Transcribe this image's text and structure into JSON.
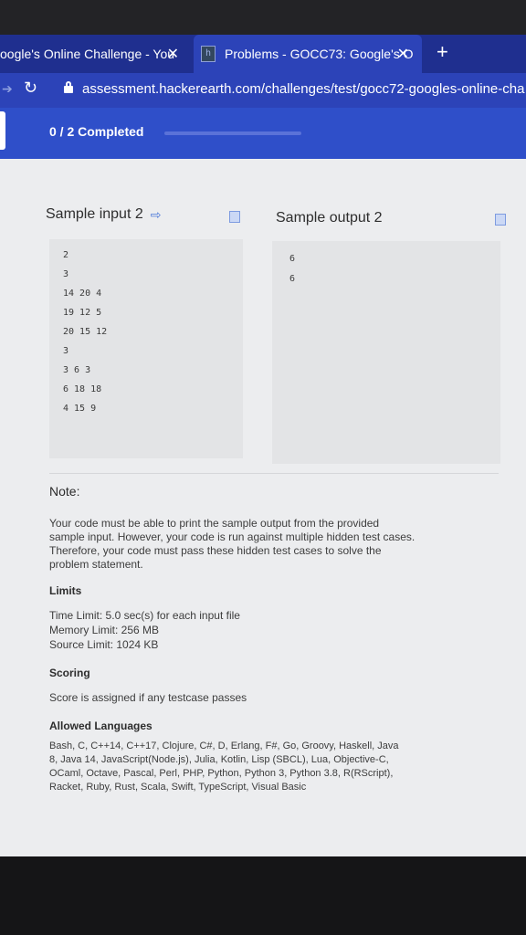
{
  "browser": {
    "tabs": [
      {
        "title": "oogle's Online Challenge - You",
        "close": "✕",
        "active": false
      },
      {
        "title": "Problems - GOCC73: Google's O",
        "close": "✕",
        "active": true
      }
    ],
    "new_tab": "+",
    "url": "assessment.hackerearth.com/challenges/test/gocc72-googles-online-cha"
  },
  "progress": {
    "text": "0 / 2 Completed",
    "fraction": 0.0
  },
  "sample_input": {
    "heading": "Sample input 2",
    "lines": [
      "2",
      "3",
      "14 20 4",
      "19 12 5",
      "20 15 12",
      "3",
      "3 6 3",
      "6 18 18",
      "4 15 9"
    ]
  },
  "sample_output": {
    "heading": "Sample output 2",
    "lines": [
      "6",
      "6"
    ]
  },
  "note": {
    "title": "Note:",
    "lines": [
      "Your code must be able to print the sample output from the provided",
      "sample input. However, your code is run against multiple hidden test cases.",
      "Therefore, your code must pass these hidden test cases to solve the",
      "problem statement."
    ]
  },
  "limits": {
    "title": "Limits",
    "time": "Time Limit: 5.0 sec(s) for each input file",
    "memory": "Memory Limit: 256 MB",
    "source": "Source Limit: 1024 KB"
  },
  "scoring": {
    "title": "Scoring",
    "text": "Score is assigned if any testcase passes"
  },
  "languages": {
    "title": "Allowed Languages",
    "lines": [
      "Bash, C, C++14, C++17, Clojure, C#, D, Erlang, F#, Go, Groovy, Haskell, Java",
      "8, Java 14, JavaScript(Node.js), Julia, Kotlin, Lisp (SBCL), Lua, Objective-C,",
      "OCaml, Octave, Pascal, Perl, PHP, Python, Python 3, Python 3.8, R(RScript),",
      "Racket, Ruby, Rust, Scala, Swift, TypeScript, Visual Basic"
    ]
  }
}
